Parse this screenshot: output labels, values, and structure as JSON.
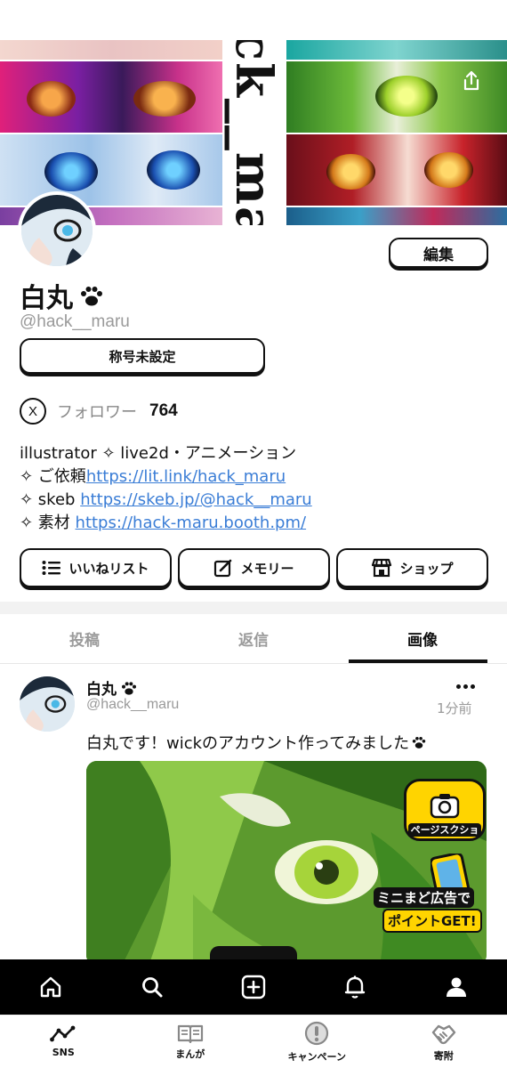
{
  "banner": {
    "title": "hack__maru"
  },
  "profile": {
    "name": "白丸",
    "handle": "@hack__maru",
    "edit_label": "編集",
    "title_label": "称号未設定",
    "x_icon_label": "X",
    "followers_label": "フォロワー",
    "followers_count": "764",
    "bio": {
      "line1": "illustrator ✧ live2d・アニメーション",
      "line2_prefix": "✧ ご依頼",
      "line2_link": "https://lit.link/hack_maru",
      "line3_prefix": "✧ skeb ",
      "line3_link": "https://skeb.jp/@hack__maru",
      "line4_prefix": "✧ 素材 ",
      "line4_link": "https://hack-maru.booth.pm/"
    },
    "actions": {
      "likes": "いいねリスト",
      "memory": "メモリー",
      "shop": "ショップ"
    }
  },
  "tabs": {
    "posts": "投稿",
    "replies": "返信",
    "images": "画像"
  },
  "post": {
    "name": "白丸",
    "handle": "@hack__maru",
    "time": "1分前",
    "text": "白丸です！wickのアカウント作ってみました"
  },
  "ads": {
    "screenshot_label": "ページスクショ",
    "mini_line1": "ミニまど広告で",
    "mini_line2": "ポイントGET!"
  },
  "bottom_nav": {
    "icons": [
      "home-icon",
      "search-icon",
      "plus-icon",
      "bell-icon",
      "user-icon"
    ]
  },
  "app_switcher": {
    "sns": "SNS",
    "manga": "まんが",
    "campaign": "キャンペーン",
    "donate": "寄附"
  },
  "colors": {
    "link": "#3a7dd6",
    "ad_yellow": "#ffd400",
    "nav_bg": "#000000"
  }
}
